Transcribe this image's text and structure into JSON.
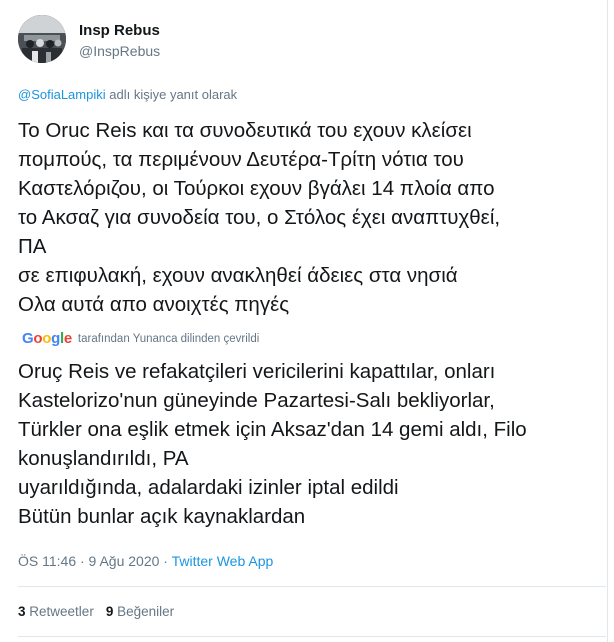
{
  "author": {
    "name": "Insp Rebus",
    "handle": "@InspRebus",
    "avatar_icon": "profile-photo-icon"
  },
  "reply": {
    "mention": "@SofiaLampiki",
    "suffix": "adlı kişiye yanıt olarak"
  },
  "tweet": {
    "text": "Το Oruc Reis και τα συνοδευτικά του εχουν κλείσει\nπομπούς, τα περιμένουν Δευτέρα-Τρίτη νότια του\nΚαστελόριζου, οι Τούρκοι εχουν βγάλει 14 πλοία απο\nτο Ακσαζ για συνοδεία του, ο Στόλος έχει αναπτυχθεί,\nΠΑ\n σε επιφυλακή, εχουν ανακληθεί άδειες στα νησιά\nΟλα αυτά απο ανοιχτές πηγές"
  },
  "translation": {
    "logo": "Google",
    "label": "tarafından Yunanca dilinden çevrildi",
    "text": "Oruç Reis ve refakatçileri vericilerini kapattılar, onları\nKastelorizo'nun güneyinde Pazartesi-Salı bekliyorlar,\nTürkler ona eşlik etmek için Aksaz'dan 14 gemi aldı, Filo\nkonuşlandırıldı, PA\n uyarıldığında, adalardaki izinler iptal edildi\n Bütün bunlar açık kaynaklardan"
  },
  "meta": {
    "time": "ÖS 11:46 · 9 Ağu 2020 ·",
    "source": "Twitter Web App"
  },
  "stats": {
    "retweets_count": "3",
    "retweets_label": "Retweetler",
    "likes_count": "9",
    "likes_label": "Beğeniler"
  },
  "colors": {
    "link": "#1b95e0",
    "muted": "#657786",
    "text": "#14171a",
    "border": "#e1e8ed"
  }
}
